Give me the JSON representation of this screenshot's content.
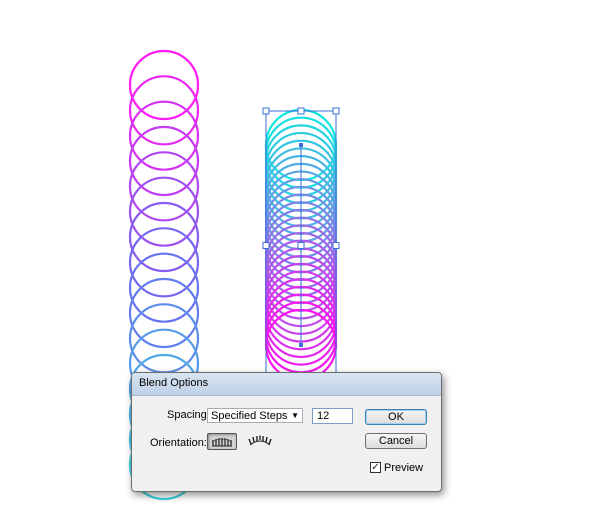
{
  "dialog": {
    "title": "Blend Options",
    "spacing_label": "Spacing:",
    "spacing_value": "Specified Steps",
    "steps_value": "12",
    "orientation_label": "Orientation:",
    "ok_label": "OK",
    "cancel_label": "Cancel",
    "preview_label": "Preview",
    "preview_checked": true
  },
  "artwork": {
    "left_blend": {
      "colors": [
        "#ff1cf4",
        "#6a6cf0",
        "#3fd0e0"
      ]
    },
    "right_blend": {
      "colors": [
        "#11e6e0",
        "#ff10f0"
      ]
    },
    "selection_color": "#3a6fd8"
  }
}
